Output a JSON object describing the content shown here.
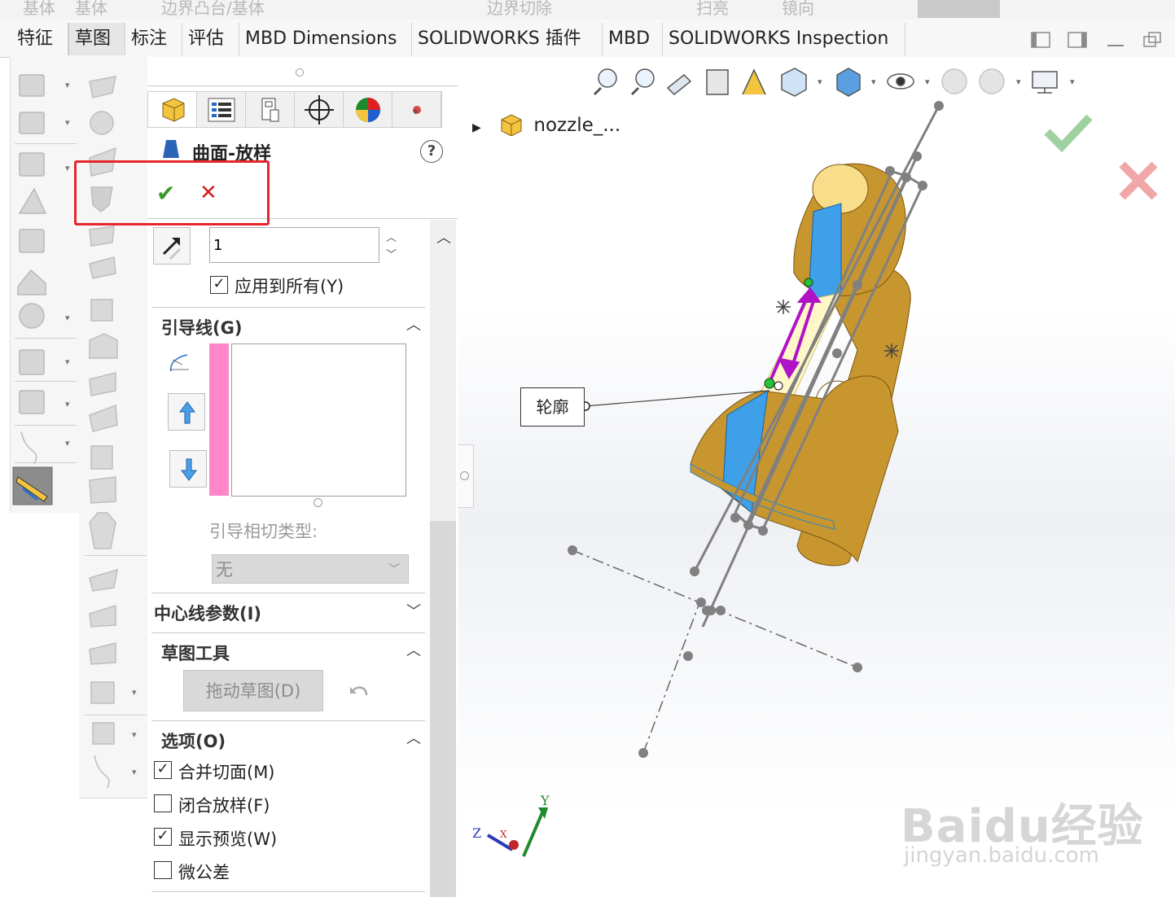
{
  "top_strip": {
    "items": [
      "基体",
      "基体",
      "边界凸台/基体",
      "边界切除",
      "扫亮",
      "镜向"
    ]
  },
  "tabs": [
    {
      "label": "特征"
    },
    {
      "label": "草图"
    },
    {
      "label": "标注"
    },
    {
      "label": "评估"
    },
    {
      "label": "MBD Dimensions"
    },
    {
      "label": "SOLIDWORKS 插件"
    },
    {
      "label": "MBD"
    },
    {
      "label": "SOLIDWORKS Inspection"
    }
  ],
  "property_manager": {
    "title": "曲面-放样",
    "help": "?",
    "ok_symbol": "✔",
    "cancel_symbol": "✕",
    "tangency_value": "1",
    "apply_to_all_label": "应用到所有(Y)",
    "guides": {
      "header": "引导线(G)",
      "tangency_type_label": "引导相切类型:",
      "tangency_type_value": "无"
    },
    "centerline": {
      "header": "中心线参数(I)"
    },
    "sketch_tools": {
      "header": "草图工具",
      "drag_sketch_label": "拖动草图(D)"
    },
    "options": {
      "header": "选项(O)",
      "items": [
        {
          "label": "合并切面(M)",
          "checked": true
        },
        {
          "label": "闭合放样(F)",
          "checked": false
        },
        {
          "label": "显示预览(W)",
          "checked": true
        },
        {
          "label": "微公差",
          "checked": false
        }
      ]
    }
  },
  "graphics": {
    "tree_item_label": "nozzle_...",
    "profile_callout": "轮廓",
    "axis_labels": {
      "x": "X",
      "y": "Y",
      "z": "Z"
    },
    "watermark": "Baidu经验",
    "watermark_sub": "jingyan.baidu.com"
  },
  "colors": {
    "highlight": "#e8252e",
    "body": "#c8962e",
    "face_blue": "#3ea0e8",
    "guide_pink": "#ff86c8",
    "ok_green": "#3a9a2a",
    "cancel_red": "#d22020"
  }
}
